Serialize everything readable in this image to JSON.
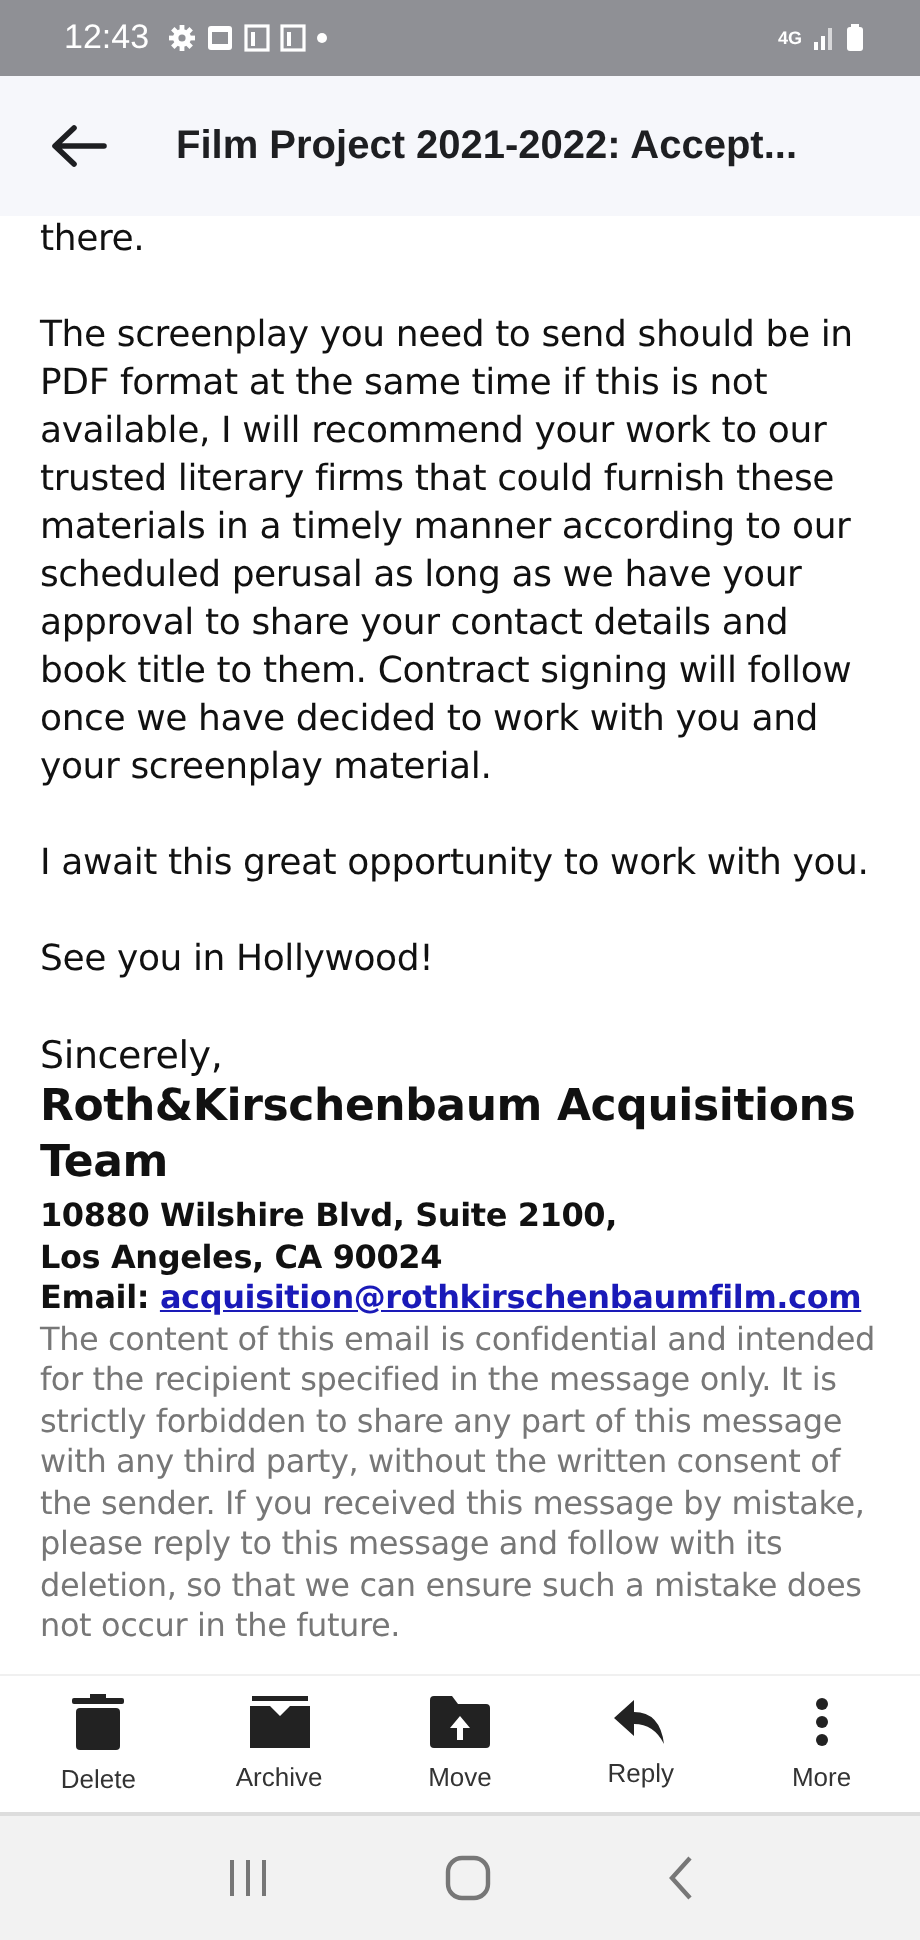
{
  "status_bar": {
    "time": "12:43",
    "network": "4G"
  },
  "header": {
    "title": "Film Project 2021-2022: Accept..."
  },
  "body": {
    "paragraphs": [
      "there.",
      "The screenplay you need to send should be in PDF format at the same time if this is not available, I will recommend your work to our trusted literary firms that could furnish these materials in a timely manner according to our scheduled perusal as long as we have your approval to share your contact details and book title to them. Contract signing will follow once we have decided to work with you and your screenplay material.",
      "I await this great opportunity to work with you.",
      "See you in Hollywood!"
    ],
    "closing": "Sincerely,",
    "signature": "Roth&Kirschenbaum Acquisitions Team",
    "address": [
      "10880 Wilshire Blvd, Suite 2100,",
      "Los Angeles, CA 90024"
    ],
    "email_label": "Email:",
    "email": "acquisition@rothkirschenbaumfilm.com",
    "disclaimer": "The content of this email is confidential and intended for the recipient specified in the message only. It is strictly forbidden to share any part of this message with any third party, without the written consent of the sender. If you received this message by mistake, please reply to this message and follow with its deletion, so that we can ensure such a mistake does not occur in the future."
  },
  "toolbar": [
    {
      "kind": "delete",
      "label": "Delete"
    },
    {
      "kind": "archive",
      "label": "Archive"
    },
    {
      "kind": "move",
      "label": "Move"
    },
    {
      "kind": "reply",
      "label": "Reply"
    },
    {
      "kind": "more",
      "label": "More"
    }
  ]
}
